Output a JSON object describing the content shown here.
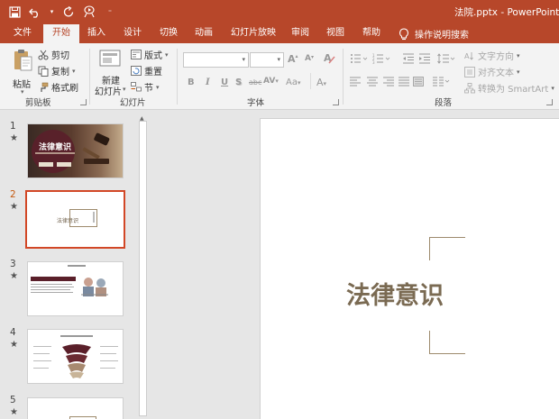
{
  "window": {
    "doc_title": "法院.pptx - PowerPoint"
  },
  "tabs": [
    {
      "label": "文件"
    },
    {
      "label": "开始",
      "active": true
    },
    {
      "label": "插入"
    },
    {
      "label": "设计"
    },
    {
      "label": "切换"
    },
    {
      "label": "动画"
    },
    {
      "label": "幻灯片放映"
    },
    {
      "label": "审阅"
    },
    {
      "label": "视图"
    },
    {
      "label": "帮助"
    }
  ],
  "tellme": {
    "label": "操作说明搜索"
  },
  "ribbon": {
    "clipboard": {
      "paste": "粘贴",
      "cut": "剪切",
      "copy": "复制",
      "format_painter": "格式刷",
      "group": "剪贴板"
    },
    "slides": {
      "new_slide_line1": "新建",
      "new_slide_line2": "幻灯片",
      "layout": "版式",
      "reset": "重置",
      "section": "节",
      "group": "幻灯片"
    },
    "font": {
      "group": "字体",
      "bold": "B",
      "italic": "I",
      "underline": "U",
      "shadow": "S",
      "strike": "abc",
      "spacing": "AV",
      "case": "Aa",
      "color": "A"
    },
    "paragraph": {
      "text_direction": "文字方向",
      "align_text": "对齐文本",
      "smartart": "转换为 SmartArt",
      "group": "段落"
    }
  },
  "slides": [
    {
      "number": "1",
      "star": "★",
      "title": "法律意识"
    },
    {
      "number": "2",
      "star": "★",
      "title": "法律意识",
      "selected": true
    },
    {
      "number": "3",
      "star": "★"
    },
    {
      "number": "4",
      "star": "★"
    },
    {
      "number": "5",
      "star": "★"
    }
  ],
  "main_slide": {
    "title": "法律意识"
  },
  "colors": {
    "accent": "#b7472a",
    "selection": "#d24726"
  }
}
